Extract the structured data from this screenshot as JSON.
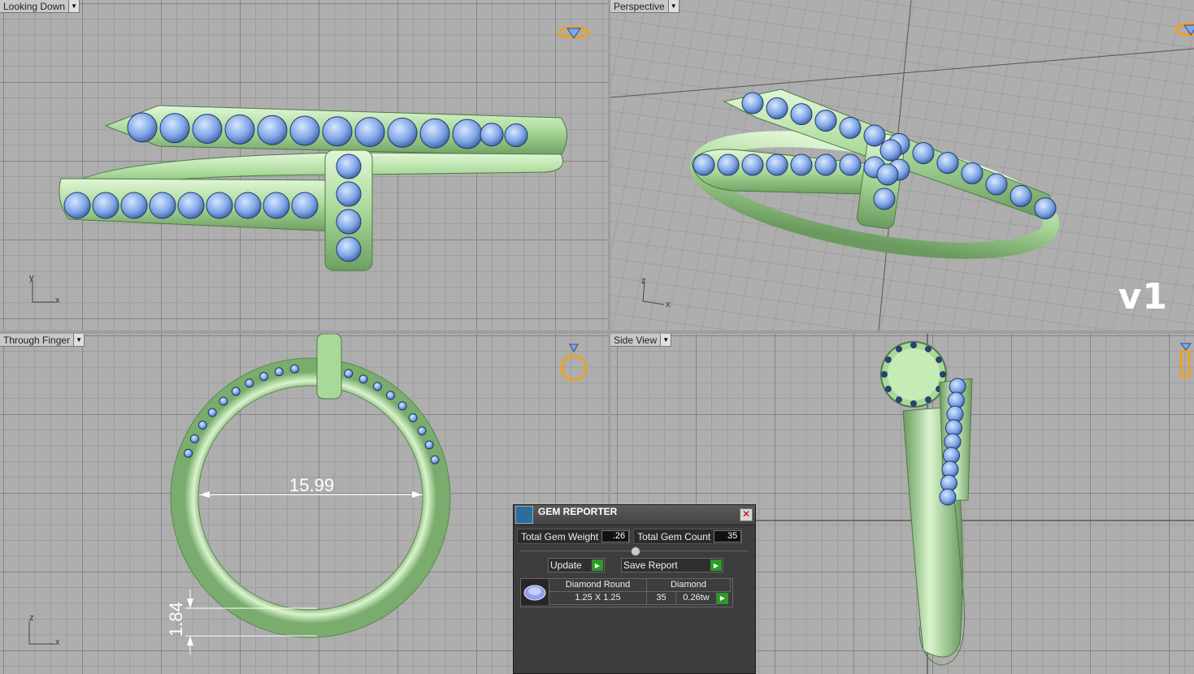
{
  "viewports": {
    "top_left": {
      "label": "Looking Down",
      "axis_y": "y",
      "axis_x": "x"
    },
    "top_right": {
      "label": "Perspective",
      "axis_y": "z",
      "axis_x": "x",
      "version": "v1"
    },
    "bottom_left": {
      "label": "Through Finger",
      "axis_y": "z",
      "axis_x": "x",
      "dimension_inner": "15.99",
      "dimension_thickness": "1.84"
    },
    "bottom_right": {
      "label": "Side View"
    }
  },
  "gem_reporter": {
    "title": "GEM REPORTER",
    "close_icon": "close-icon",
    "total_weight_label": "Total Gem Weight",
    "total_weight_value": ".26",
    "total_count_label": "Total Gem Count",
    "total_count_value": "35",
    "update_label": "Update",
    "save_report_label": "Save Report",
    "table": {
      "headers": [
        "Diamond Round",
        "Diamond"
      ],
      "row": {
        "size": "1.25 X 1.25",
        "count": "35",
        "weight": "0.26tw"
      }
    }
  },
  "colors": {
    "metal": "#b9e6a9",
    "gem": "#7fa8e8",
    "grid_bg": "#aeaeae",
    "accent": "#f0a020"
  }
}
